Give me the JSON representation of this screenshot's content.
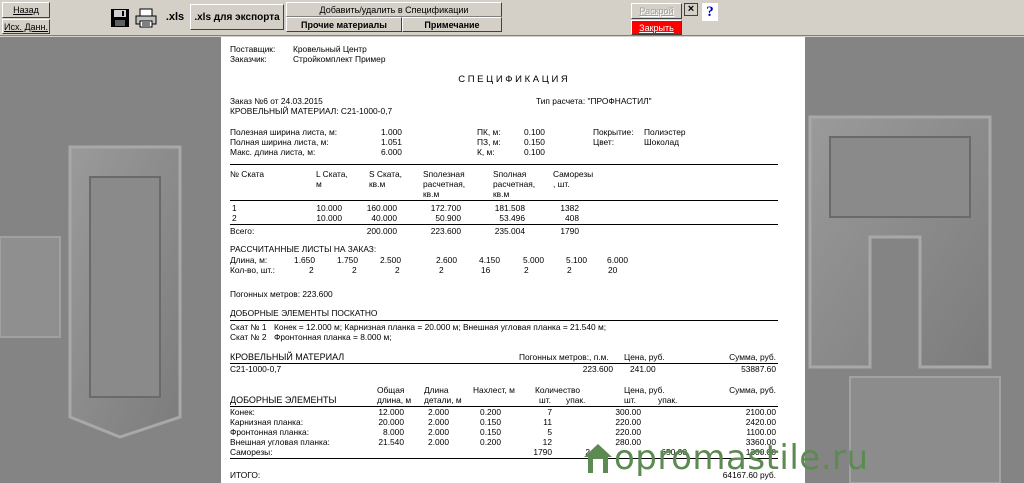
{
  "toolbar": {
    "back": "Назад",
    "source_data": "Исх. Данн.",
    "xls": ".xls",
    "xls_export": ".xls для экспорта",
    "add_remove": "Добавить/удалить в Спецификации",
    "other_materials": "Прочие материалы",
    "note": "Примечание",
    "layout": "Раскрой",
    "close": "Закрыть",
    "x": "×",
    "help": "?"
  },
  "doc": {
    "supplier_label": "Поставщик:",
    "supplier": "Кровельный Центр",
    "customer_label": "Заказчик:",
    "customer": "Стройкомплект Пример",
    "title": "С П Е Ц И Ф И К А Ц И Я",
    "order": "Заказ №6  от 24.03.2015",
    "calc_type": "Тип расчета: \"ПРОФНАСТИЛ\"",
    "roof_material": "КРОВЕЛЬНЫЙ МАТЕРИАЛ:  С21-1000-0,7",
    "params_left": [
      {
        "label": "Полезная ширина листа, м:",
        "value": "1.000"
      },
      {
        "label": "Полная ширина листа, м:",
        "value": "1.051"
      },
      {
        "label": "Макс. длина листа, м:",
        "value": "6.000"
      }
    ],
    "params_mid": [
      {
        "label": "ПК, м:",
        "value": "0.100"
      },
      {
        "label": "ПЗ, м:",
        "value": "0.150"
      },
      {
        "label": "К, м:",
        "value": "0.100"
      }
    ],
    "params_right": [
      {
        "label": "Покрытие:",
        "value": "Полиэстер"
      },
      {
        "label": "Цвет:",
        "value": "Шоколад"
      }
    ],
    "slopes_head": {
      "c1": "№ Ската",
      "c2": [
        "L Ската,",
        "м"
      ],
      "c3": [
        "S Ската,",
        "кв.м"
      ],
      "c4": [
        "Sполезная",
        "расчетная,",
        "кв.м"
      ],
      "c5": [
        "Sполная",
        "расчетная,",
        "кв.м"
      ],
      "c6": [
        "Саморезы",
        ", шт."
      ]
    },
    "slopes": [
      [
        "1",
        "10.000",
        "160.000",
        "172.700",
        "181.508",
        "1382"
      ],
      [
        "2",
        "10.000",
        "40.000",
        "50.900",
        "53.496",
        "408"
      ]
    ],
    "slopes_total": [
      "Всего:",
      "200.000",
      "223.600",
      "235.004",
      "1790"
    ],
    "sheets_title": "РАССЧИТАННЫЕ ЛИСТЫ НА ЗАКАЗ:",
    "sheets_len_label": "Длина, м:",
    "sheets_len": [
      "1.650",
      "1.750",
      "2.500",
      "2.600",
      "4.150",
      "5.000",
      "5.100",
      "6.000"
    ],
    "sheets_qty_label": "Кол-во, шт.:",
    "sheets_qty": [
      "2",
      "2",
      "2",
      "2",
      "16",
      "2",
      "2",
      "20"
    ],
    "running_meters": "Погонных метров:  223.600",
    "extras_title": "ДОБОРНЫЕ ЭЛЕМЕНТЫ ПОСКАТНО",
    "extras_slope1_label": "Скат № 1",
    "extras_slope1": "Конек = 12.000 м;   Карнизная планка = 20.000 м;   Внешная угловая планка = 21.540 м;",
    "extras_slope2_label": "Скат № 2",
    "extras_slope2": "Фронтонная планка = 8.000 м;",
    "mat_head": {
      "title": "КРОВЕЛЬНЫЙ МАТЕРИАЛ",
      "meters": "Погонных метров:, п.м.",
      "price": "Цена, руб.",
      "sum": "Сумма,  руб."
    },
    "mat_row": {
      "name": "С21-1000-0,7",
      "meters": "223.600",
      "price": "241.00",
      "sum": "53887.60"
    },
    "el_head": {
      "name": "ДОБОРНЫЕ ЭЛЕМЕНТЫ",
      "total_len": [
        "Общая",
        "длина, м"
      ],
      "part_len": [
        "Длина",
        "детали, м"
      ],
      "overlap": "Нахлест, м",
      "qty": "Количество",
      "qty_pcs": "шт.",
      "qty_pack": "упак.",
      "price": "Цена, руб.",
      "price_pcs": "шт.",
      "price_pack": "упак.",
      "sum": "Сумма,  руб."
    },
    "elements": [
      {
        "name": "Конек:",
        "total": "12.000",
        "part": "2.000",
        "overlap": "0.200",
        "qty": "7",
        "pack": "",
        "price": "300.00",
        "price_pack": "",
        "sum": "2100.00"
      },
      {
        "name": "Карнизная планка:",
        "total": "20.000",
        "part": "2.000",
        "overlap": "0.150",
        "qty": "11",
        "pack": "",
        "price": "220.00",
        "price_pack": "",
        "sum": "2420.00"
      },
      {
        "name": "Фронтонная планка:",
        "total": "8.000",
        "part": "2.000",
        "overlap": "0.150",
        "qty": "5",
        "pack": "",
        "price": "220.00",
        "price_pack": "",
        "sum": "1100.00"
      },
      {
        "name": "Внешная угловая планка:",
        "total": "21.540",
        "part": "2.000",
        "overlap": "0.200",
        "qty": "12",
        "pack": "",
        "price": "280.00",
        "price_pack": "",
        "sum": "3360.00"
      },
      {
        "name": "Саморезы:",
        "total": "",
        "part": "",
        "overlap": "",
        "qty": "1790",
        "pack": "2",
        "price": "",
        "price_pack": "650.00",
        "sum": "1300.00"
      }
    ],
    "total_label": "ИТОГО:",
    "total_value": "64167.60 руб."
  },
  "watermark": {
    "text": "opromastile.ru"
  },
  "colors": {
    "close_btn": "#ff0000",
    "help": "#0000cc",
    "watermark": "#5d8a52"
  }
}
